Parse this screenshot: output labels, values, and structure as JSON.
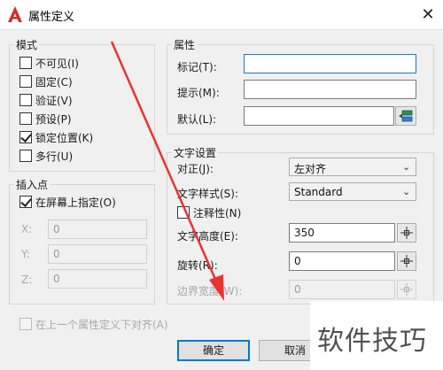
{
  "window": {
    "title": "属性定义",
    "close_label": "✕"
  },
  "mode": {
    "title": "模式",
    "items": [
      {
        "label": "不可见(I)",
        "checked": false
      },
      {
        "label": "固定(C)",
        "checked": false
      },
      {
        "label": "验证(V)",
        "checked": false
      },
      {
        "label": "预设(P)",
        "checked": false
      },
      {
        "label": "锁定位置(K)",
        "checked": true
      },
      {
        "label": "多行(U)",
        "checked": false
      }
    ]
  },
  "insertion": {
    "title": "插入点",
    "specify_label": "在屏幕上指定(O)",
    "specify_checked": true,
    "x_label": "X:",
    "x_value": "0",
    "y_label": "Y:",
    "y_value": "0",
    "z_label": "Z:",
    "z_value": "0"
  },
  "attribute": {
    "title": "属性",
    "tag_label": "标记(T):",
    "tag_value": "",
    "prompt_label": "提示(M):",
    "prompt_value": "",
    "default_label": "默认(L):",
    "default_value": ""
  },
  "text_settings": {
    "title": "文字设置",
    "justify_label": "对正(J):",
    "justify_value": "左对齐",
    "style_label": "文字样式(S):",
    "style_value": "Standard",
    "annotative_label": "注释性(N)",
    "annotative_checked": false,
    "height_label": "文字高度(E):",
    "height_value": "350",
    "rotation_label": "旋转(R):",
    "rotation_value": "0",
    "boundary_label": "边界宽度(W):",
    "boundary_value": "0"
  },
  "align_below": {
    "label": "在上一个属性定义下对齐(A)",
    "checked": false
  },
  "buttons": {
    "ok": "确定",
    "cancel": "取消"
  },
  "watermark": {
    "text": "软件技巧"
  },
  "colors": {
    "accent": "#0078d7",
    "arrow": "#e8342f",
    "icon_red": "#d32f2f"
  }
}
